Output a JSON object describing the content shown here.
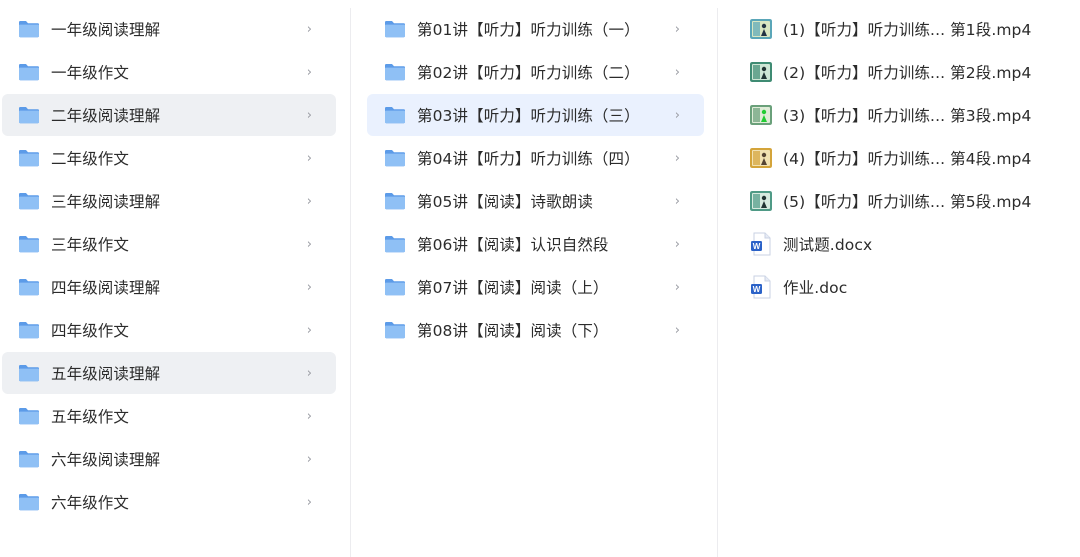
{
  "column1": {
    "items": [
      {
        "label": "一年级阅读理解",
        "state": "normal"
      },
      {
        "label": "一年级作文",
        "state": "normal"
      },
      {
        "label": "二年级阅读理解",
        "state": "selected"
      },
      {
        "label": "二年级作文",
        "state": "normal"
      },
      {
        "label": "三年级阅读理解",
        "state": "normal"
      },
      {
        "label": "三年级作文",
        "state": "normal"
      },
      {
        "label": "四年级阅读理解",
        "state": "normal"
      },
      {
        "label": "四年级作文",
        "state": "normal"
      },
      {
        "label": "五年级阅读理解",
        "state": "hover"
      },
      {
        "label": "五年级作文",
        "state": "normal"
      },
      {
        "label": "六年级阅读理解",
        "state": "normal"
      },
      {
        "label": "六年级作文",
        "state": "normal"
      }
    ]
  },
  "column2": {
    "items": [
      {
        "label": "第01讲【听力】听力训练（一）",
        "state": "normal"
      },
      {
        "label": "第02讲【听力】听力训练（二）",
        "state": "normal"
      },
      {
        "label": "第03讲【听力】听力训练（三）",
        "state": "active"
      },
      {
        "label": "第04讲【听力】听力训练（四）",
        "state": "normal"
      },
      {
        "label": "第05讲【阅读】诗歌朗读",
        "state": "normal"
      },
      {
        "label": "第06讲【阅读】认识自然段",
        "state": "normal"
      },
      {
        "label": "第07讲【阅读】阅读（上）",
        "state": "normal"
      },
      {
        "label": "第08讲【阅读】阅读（下）",
        "state": "normal"
      }
    ]
  },
  "column3": {
    "items": [
      {
        "label": "(1)【听力】听力训练...  第1段.mp4",
        "icon": "video-thumbnail-icon"
      },
      {
        "label": "(2)【听力】听力训练...  第2段.mp4",
        "icon": "video-thumbnail-icon"
      },
      {
        "label": "(3)【听力】听力训练...  第3段.mp4",
        "icon": "video-thumbnail-icon"
      },
      {
        "label": "(4)【听力】听力训练...  第4段.mp4",
        "icon": "video-thumbnail-icon"
      },
      {
        "label": "(5)【听力】听力训练...  第5段.mp4",
        "icon": "video-thumbnail-icon"
      },
      {
        "label": "测试题.docx",
        "icon": "word-doc-icon"
      },
      {
        "label": "作业.doc",
        "icon": "word-doc-icon"
      }
    ]
  },
  "icons": {
    "folder": "folder-icon",
    "chevron": "›"
  },
  "colors": {
    "folder_blue": "#6aa7ef",
    "selected_bg": "#eef0f3",
    "active_bg": "#eaf1fe",
    "chevron": "#9a9ca3",
    "word_blue": "#2b62c8"
  }
}
